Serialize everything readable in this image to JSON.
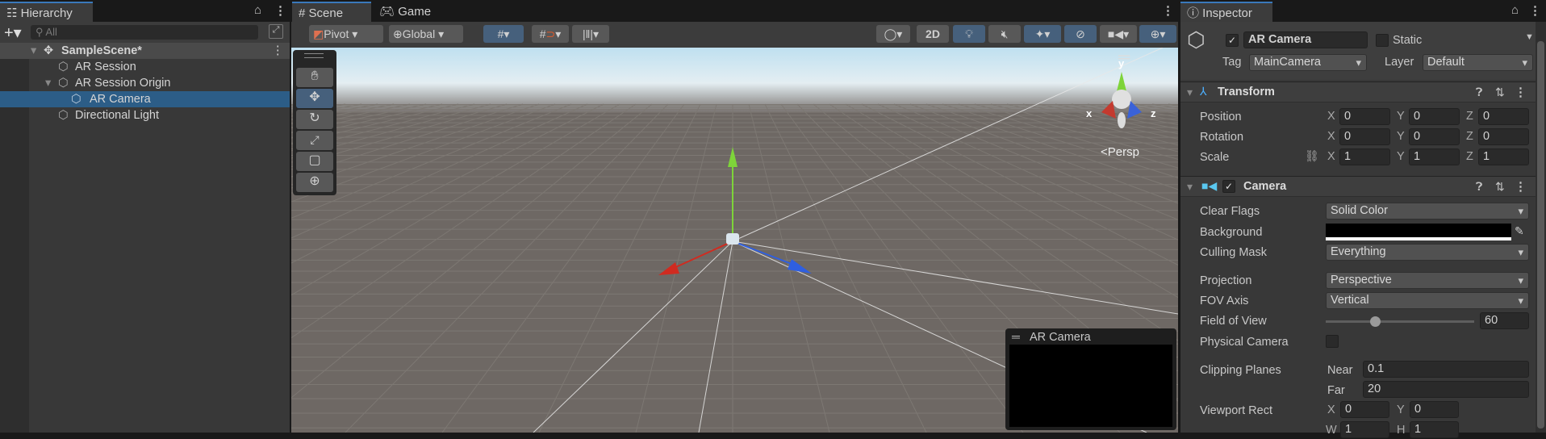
{
  "hierarchy": {
    "tab": "Hierarchy",
    "search_placeholder": "All",
    "scene": "SampleScene*",
    "items": [
      {
        "label": "AR Session"
      },
      {
        "label": "AR Session Origin"
      },
      {
        "label": "AR Camera",
        "selected": true
      },
      {
        "label": "Directional Light"
      }
    ]
  },
  "scene_view": {
    "tabs": [
      {
        "label": "Scene"
      },
      {
        "label": "Game"
      }
    ],
    "pivot": "Pivot",
    "global": "Global",
    "btn_2d": "2D",
    "persp": "<Persp",
    "gizmo": {
      "x": "x",
      "y": "y",
      "z": "z"
    },
    "camera_preview_title": "AR Camera",
    "colors": {
      "x_axis": "#d02b20",
      "y_axis": "#7ed43a",
      "z_axis": "#2f5fe0"
    }
  },
  "inspector": {
    "tab": "Inspector",
    "object_name": "AR Camera",
    "active": true,
    "static_label": "Static",
    "tag_label": "Tag",
    "tag": "MainCamera",
    "layer_label": "Layer",
    "layer": "Default",
    "transform": {
      "title": "Transform",
      "position": {
        "label": "Position",
        "x": "0",
        "y": "0",
        "z": "0"
      },
      "rotation": {
        "label": "Rotation",
        "x": "0",
        "y": "0",
        "z": "0"
      },
      "scale": {
        "label": "Scale",
        "x": "1",
        "y": "1",
        "z": "1"
      }
    },
    "camera": {
      "title": "Camera",
      "clear_flags": {
        "label": "Clear Flags",
        "value": "Solid Color"
      },
      "background": {
        "label": "Background",
        "color": "#000000"
      },
      "culling_mask": {
        "label": "Culling Mask",
        "value": "Everything"
      },
      "projection": {
        "label": "Projection",
        "value": "Perspective"
      },
      "fov_axis": {
        "label": "FOV Axis",
        "value": "Vertical"
      },
      "field_of_view": {
        "label": "Field of View",
        "value": "60"
      },
      "physical_camera": {
        "label": "Physical Camera",
        "checked": false
      },
      "clipping": {
        "label": "Clipping Planes",
        "near_label": "Near",
        "near": "0.1",
        "far_label": "Far",
        "far": "20"
      },
      "viewport": {
        "label": "Viewport Rect",
        "x": "0",
        "y": "0",
        "w": "1",
        "h": "1"
      }
    }
  },
  "axis_labels": {
    "x": "X",
    "y": "Y",
    "z": "Z",
    "w": "W",
    "h": "H"
  }
}
